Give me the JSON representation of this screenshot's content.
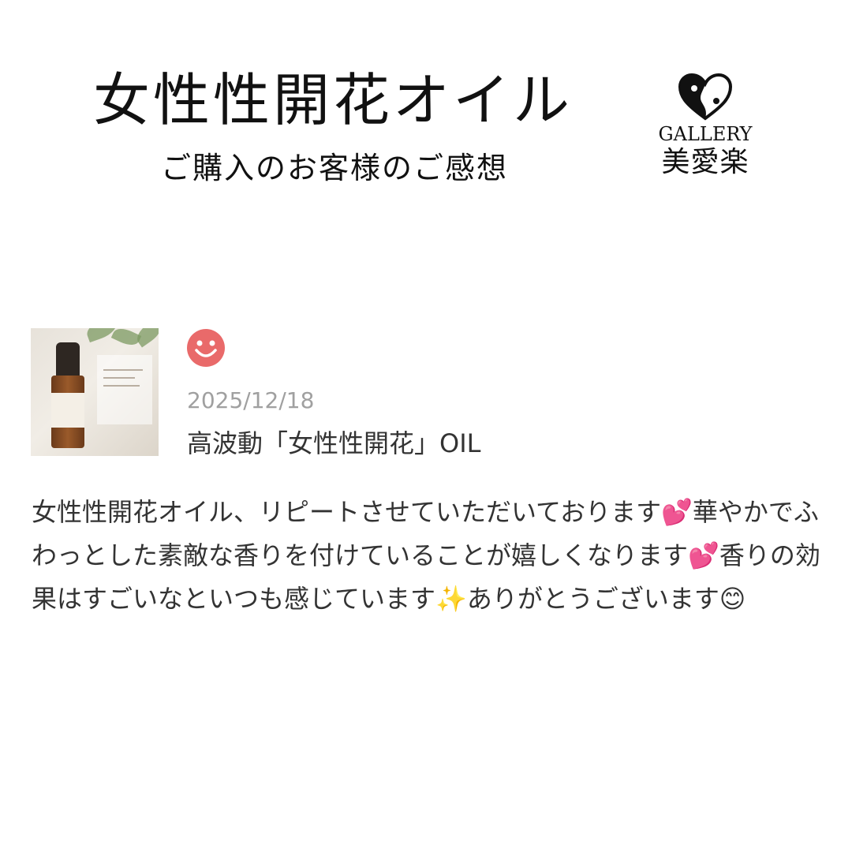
{
  "header": {
    "title": "女性性開花オイル",
    "subtitle": "ご購入のお客様のご感想"
  },
  "logo": {
    "icon": "heart-yin-yang-icon",
    "gallery_text": "GALLERY",
    "brand_name": "美愛楽"
  },
  "review": {
    "thumbnail": "product-bottle-photo",
    "rating_icon": "smiley-face-icon",
    "rating_color": "#e96a6a",
    "date": "2025/12/18",
    "product_name": "高波動「女性性開花」OIL",
    "text": "女性性開花オイル、リピートさせていただいております💕華やかでふわっとした素敵な香りを付けていることが嬉しくなります💕香りの効果はすごいなといつも感じています✨ありがとうございます😊"
  }
}
